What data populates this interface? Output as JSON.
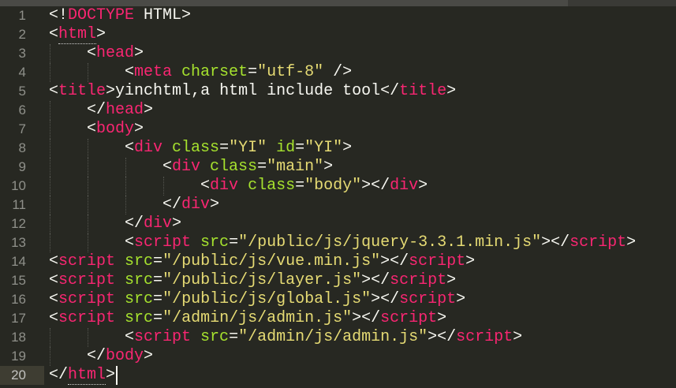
{
  "editor": {
    "active_line": 20,
    "colors": {
      "background": "#272822",
      "tag": "#f92672",
      "attr": "#a6e22e",
      "string": "#e6db74",
      "text": "#f8f8f2"
    },
    "lines": [
      [
        [
          "punct",
          "<!"
        ],
        [
          "tag",
          "DOCTYPE"
        ],
        [
          "punct",
          " HTML>"
        ]
      ],
      [
        [
          "punct",
          "<"
        ],
        [
          "tag",
          "html"
        ],
        [
          "punct",
          ">"
        ]
      ],
      [
        [
          "punct",
          "    <"
        ],
        [
          "tag",
          "head"
        ],
        [
          "punct",
          ">"
        ]
      ],
      [
        [
          "punct",
          "        <"
        ],
        [
          "tag",
          "meta"
        ],
        [
          "attr",
          " charset"
        ],
        [
          "punct",
          "="
        ],
        [
          "str",
          "\"utf-8\""
        ],
        [
          "punct",
          " />"
        ]
      ],
      [
        [
          "punct",
          "<"
        ],
        [
          "tag",
          "title"
        ],
        [
          "punct",
          ">"
        ],
        [
          "text",
          "yinchtml,a html include tool"
        ],
        [
          "punct",
          "</"
        ],
        [
          "tag",
          "title"
        ],
        [
          "punct",
          ">"
        ]
      ],
      [
        [
          "punct",
          "    </"
        ],
        [
          "tag",
          "head"
        ],
        [
          "punct",
          ">"
        ]
      ],
      [
        [
          "punct",
          "    <"
        ],
        [
          "tag",
          "body"
        ],
        [
          "punct",
          ">"
        ]
      ],
      [
        [
          "punct",
          "        <"
        ],
        [
          "tag",
          "div"
        ],
        [
          "attr",
          " class"
        ],
        [
          "punct",
          "="
        ],
        [
          "str",
          "\"YI\""
        ],
        [
          "attr",
          " id"
        ],
        [
          "punct",
          "="
        ],
        [
          "str",
          "\"YI\""
        ],
        [
          "punct",
          ">"
        ]
      ],
      [
        [
          "punct",
          "            <"
        ],
        [
          "tag",
          "div"
        ],
        [
          "attr",
          " class"
        ],
        [
          "punct",
          "="
        ],
        [
          "str",
          "\"main\""
        ],
        [
          "punct",
          ">"
        ]
      ],
      [
        [
          "punct",
          "                <"
        ],
        [
          "tag",
          "div"
        ],
        [
          "attr",
          " class"
        ],
        [
          "punct",
          "="
        ],
        [
          "str",
          "\"body\""
        ],
        [
          "punct",
          "></"
        ],
        [
          "tag",
          "div"
        ],
        [
          "punct",
          ">"
        ]
      ],
      [
        [
          "punct",
          "            </"
        ],
        [
          "tag",
          "div"
        ],
        [
          "punct",
          ">"
        ]
      ],
      [
        [
          "punct",
          "        </"
        ],
        [
          "tag",
          "div"
        ],
        [
          "punct",
          ">"
        ]
      ],
      [
        [
          "punct",
          "        <"
        ],
        [
          "tag",
          "script"
        ],
        [
          "attr",
          " src"
        ],
        [
          "punct",
          "="
        ],
        [
          "str",
          "\"/public/js/jquery-3.3.1.min.js\""
        ],
        [
          "punct",
          "></"
        ],
        [
          "tag",
          "script"
        ],
        [
          "punct",
          ">"
        ]
      ],
      [
        [
          "punct",
          "<"
        ],
        [
          "tag",
          "script"
        ],
        [
          "attr",
          " src"
        ],
        [
          "punct",
          "="
        ],
        [
          "str",
          "\"/public/js/vue.min.js\""
        ],
        [
          "punct",
          "></"
        ],
        [
          "tag",
          "script"
        ],
        [
          "punct",
          ">"
        ]
      ],
      [
        [
          "punct",
          "<"
        ],
        [
          "tag",
          "script"
        ],
        [
          "attr",
          " src"
        ],
        [
          "punct",
          "="
        ],
        [
          "str",
          "\"/public/js/layer.js\""
        ],
        [
          "punct",
          "></"
        ],
        [
          "tag",
          "script"
        ],
        [
          "punct",
          ">"
        ]
      ],
      [
        [
          "punct",
          "<"
        ],
        [
          "tag",
          "script"
        ],
        [
          "attr",
          " src"
        ],
        [
          "punct",
          "="
        ],
        [
          "str",
          "\"/public/js/global.js\""
        ],
        [
          "punct",
          "></"
        ],
        [
          "tag",
          "script"
        ],
        [
          "punct",
          ">"
        ]
      ],
      [
        [
          "punct",
          "<"
        ],
        [
          "tag",
          "script"
        ],
        [
          "attr",
          " src"
        ],
        [
          "punct",
          "="
        ],
        [
          "str",
          "\"/admin/js/admin.js\""
        ],
        [
          "punct",
          "></"
        ],
        [
          "tag",
          "script"
        ],
        [
          "punct",
          ">"
        ]
      ],
      [
        [
          "punct",
          "        <"
        ],
        [
          "tag",
          "script"
        ],
        [
          "attr",
          " src"
        ],
        [
          "punct",
          "="
        ],
        [
          "str",
          "\"/admin/js/admin.js\""
        ],
        [
          "punct",
          "></"
        ],
        [
          "tag",
          "script"
        ],
        [
          "punct",
          ">"
        ]
      ],
      [
        [
          "punct",
          "    </"
        ],
        [
          "tag",
          "body"
        ],
        [
          "punct",
          ">"
        ]
      ],
      [
        [
          "punct",
          "</"
        ],
        [
          "tag",
          "html"
        ],
        [
          "punct",
          ">"
        ]
      ]
    ]
  }
}
